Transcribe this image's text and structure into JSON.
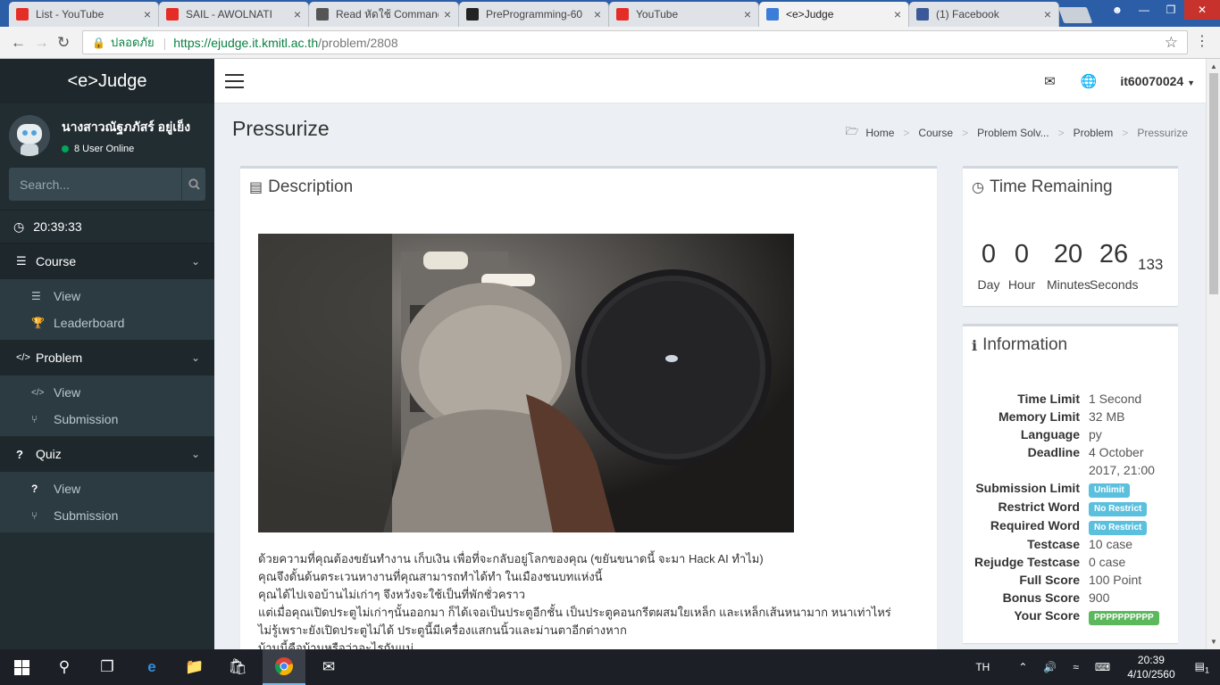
{
  "browser": {
    "tabs": [
      {
        "label": "List - YouTube",
        "icon": "youtube-icon",
        "color": "#e52d27"
      },
      {
        "label": "SAIL - AWOLNATI",
        "icon": "youtube-icon",
        "color": "#e52d27"
      },
      {
        "label": "Read หัดใช้ Command",
        "icon": "book-icon",
        "color": "#555555"
      },
      {
        "label": "PreProgramming-60",
        "icon": "github-icon",
        "color": "#222222"
      },
      {
        "label": "YouTube",
        "icon": "youtube-icon",
        "color": "#e52d27"
      },
      {
        "label": "<e>Judge",
        "icon": "it-logo-icon",
        "color": "#3b7dd8",
        "active": true
      },
      {
        "label": "(1) Facebook",
        "icon": "facebook-icon",
        "color": "#3b5998"
      }
    ],
    "secure_label": "ปลอดภัย",
    "url_host": "https://ejudge.it.kmitl.ac.th",
    "url_path": "/problem/2808"
  },
  "sidebar": {
    "brand": "<e>Judge",
    "user_name": "นางสาวณัฐภภัสร์ อยู่เย็ง",
    "online": "8 User Online",
    "search_placeholder": "Search...",
    "clock": "20:39:33",
    "sections": [
      {
        "label": "Course",
        "icon": "list-icon",
        "items": [
          {
            "label": "View",
            "icon": "list-icon"
          },
          {
            "label": "Leaderboard",
            "icon": "trophy-icon"
          }
        ]
      },
      {
        "label": "Problem",
        "icon": "code-icon",
        "items": [
          {
            "label": "View",
            "icon": "code-icon"
          },
          {
            "label": "Submission",
            "icon": "branch-icon"
          }
        ]
      },
      {
        "label": "Quiz",
        "icon": "question-icon",
        "items": [
          {
            "label": "View",
            "icon": "question-icon"
          },
          {
            "label": "Submission",
            "icon": "branch-icon"
          }
        ]
      }
    ]
  },
  "topnav": {
    "username": "it60070024"
  },
  "page": {
    "title": "Pressurize",
    "breadcrumb": [
      "Home",
      "Course",
      "Problem Solv...",
      "Problem",
      "Pressurize"
    ]
  },
  "description": {
    "heading": "Description",
    "lines": [
      "ด้วยความที่คุณต้องขยันทำงาน เก็บเงิน เพื่อที่จะกลับอยู่โลกของคุณ (ขยันขนาดนี้ จะมา Hack AI ทำไม)",
      "คุณจึงดั้นด้นตระเวนหางานที่คุณสามารถทำได้ทำ ในเมืองชนบทแห่งนี้",
      "คุณได้ไปเจอบ้านไม่เก่าๆ จึงหวังจะใช้เป็นที่พักชั่วคราว",
      "แต่เมื่อคุณเปิดประตูไม่เก่าๆนั้นออกมา ก็ได้เจอเป็นประตูอีกชั้น เป็นประตูคอนกรีตผสมใยเหล็ก และเหล็กเส้นหนามาก หนาเท่าไหร่",
      "ไม่รู้เพราะยังเปิดประตูไม่ได้ ประตูนี้มีเครื่องแสกนนิ้วและม่านตาอีกต่างหาก",
      "บ้านนี้คือบ้านหรือว่าอะไรกันแน่"
    ]
  },
  "time_remaining": {
    "heading": "Time Remaining",
    "day": "0",
    "hour": "0",
    "minutes": "20",
    "seconds": "26",
    "ms": "133",
    "labels": {
      "day": "Day",
      "hour": "Hour",
      "minutes": "Minutes",
      "seconds": "Seconds"
    }
  },
  "information": {
    "heading": "Information",
    "rows": [
      {
        "k": "Time Limit",
        "v": "1 Second"
      },
      {
        "k": "Memory Limit",
        "v": "32 MB"
      },
      {
        "k": "Language",
        "v": "py"
      },
      {
        "k": "Deadline",
        "v": "4 October 2017, 21:00"
      },
      {
        "k": "Submission Limit",
        "badge": "Unlimit",
        "badge_color": "#5bc0de"
      },
      {
        "k": "Restrict Word",
        "badge": "No Restrict",
        "badge_color": "#5bc0de"
      },
      {
        "k": "Required Word",
        "badge": "No Restrict",
        "badge_color": "#5bc0de"
      },
      {
        "k": "Testcase",
        "v": "10 case"
      },
      {
        "k": "Rejudge Testcase",
        "v": "0 case"
      },
      {
        "k": "Full Score",
        "v": "100 Point"
      },
      {
        "k": "Bonus Score",
        "v": "900"
      },
      {
        "k": "Your Score",
        "badge": "PPPPPPPPPP",
        "badge_color": "#5cb85c"
      }
    ]
  },
  "taskbar": {
    "lang": "TH",
    "time": "20:39",
    "date": "4/10/2560",
    "notif": "1"
  }
}
